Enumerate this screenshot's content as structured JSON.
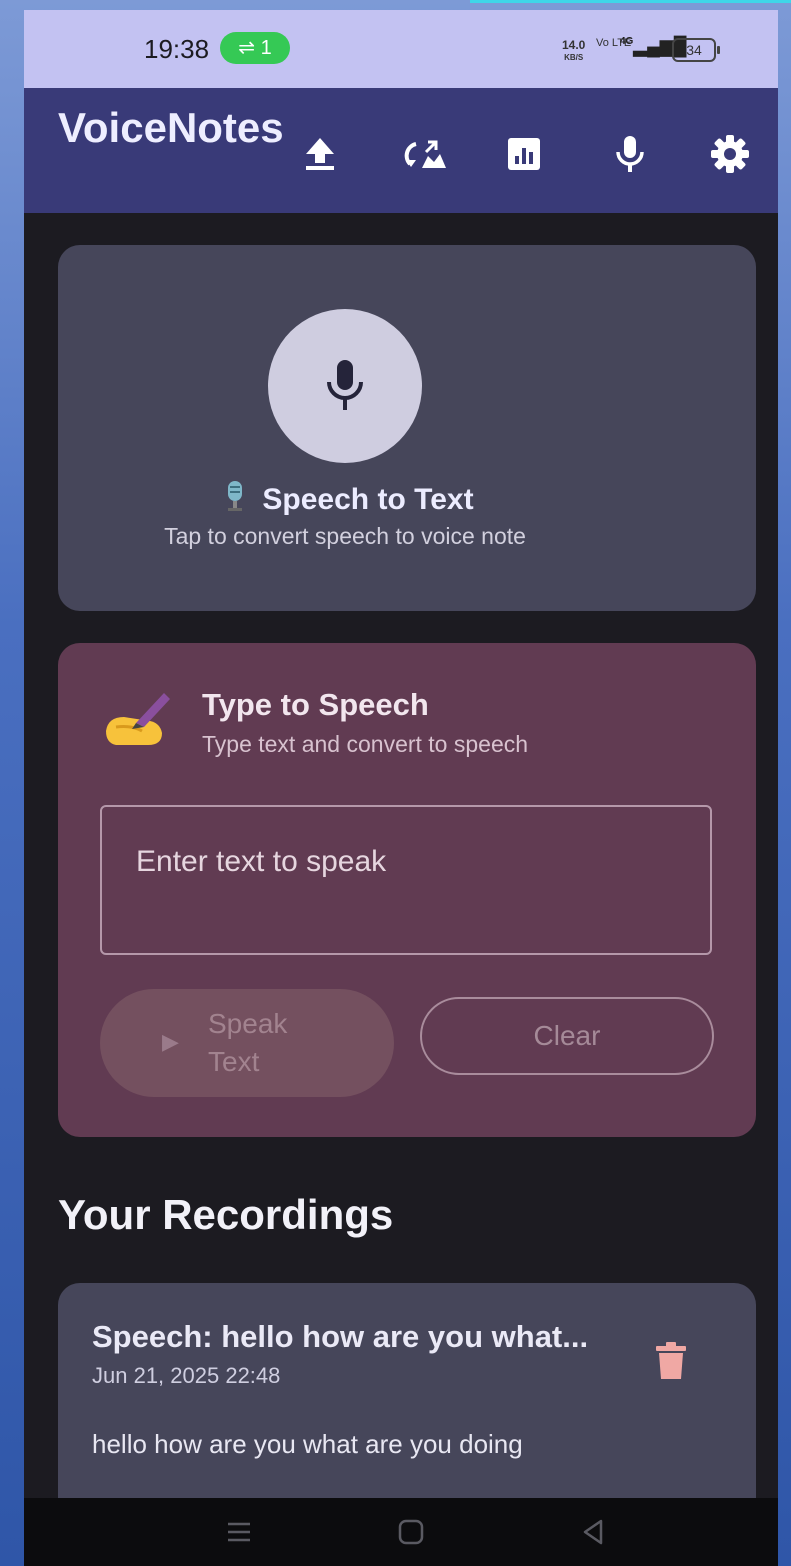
{
  "status_bar": {
    "time": "19:38",
    "hotspot_count": "1",
    "net_speed_value": "14.0",
    "net_speed_unit": "KB/S",
    "volte": "Vo LTE",
    "network": "4G",
    "battery": "34"
  },
  "app_bar": {
    "title": "VoiceNotes",
    "icons": [
      "upload-icon",
      "cloud-sync-icon",
      "stats-icon",
      "mic-icon",
      "settings-icon"
    ]
  },
  "speech_to_text": {
    "title": "Speech to Text",
    "subtitle": "Tap to convert speech to voice note",
    "icon": "microphone-emoji"
  },
  "type_to_speech": {
    "title": "Type to Speech",
    "subtitle": "Type text and convert to speech",
    "icon": "writing-hand-emoji",
    "input_placeholder": "Enter text to speak",
    "speak_label": "Speak Text",
    "clear_label": "Clear"
  },
  "recordings": {
    "heading": "Your Recordings",
    "items": [
      {
        "title": "Speech: hello how are you what...",
        "date": "Jun 21, 2025 22:48",
        "text": "hello how are you what are you doing"
      }
    ]
  },
  "colors": {
    "app_bar": "#393a78",
    "status_bar": "#c3c2f2",
    "background": "#1c1b21",
    "stt_card": "#46465a",
    "tts_card": "#613b52",
    "delete_icon": "#f0a8a4"
  }
}
